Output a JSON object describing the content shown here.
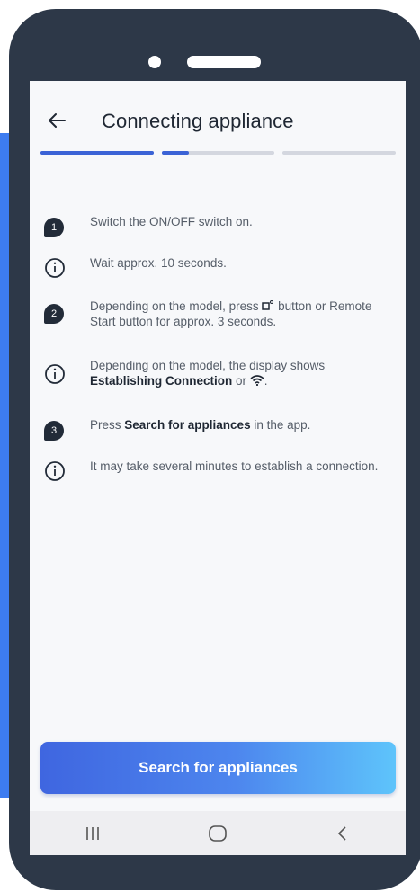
{
  "app": {
    "title": "Connecting appliance"
  },
  "progress": {
    "segments": [
      {
        "state": "complete"
      },
      {
        "state": "in-progress"
      },
      {
        "state": "pending"
      }
    ]
  },
  "steps": [
    {
      "type": "number",
      "badge": "1",
      "text_plain": "Switch the ON/OFF switch on."
    },
    {
      "type": "info",
      "icon": "info-icon",
      "text_plain": "Wait approx. 10 seconds."
    },
    {
      "type": "number",
      "badge": "2",
      "text_a": "Depending on the model, press ",
      "symbol": "remote-start-icon",
      "text_b": " button or Remote Start button for approx. 3 seconds."
    },
    {
      "type": "info",
      "icon": "info-icon",
      "text_a": "Depending on the model, the display shows ",
      "bold": "Establishing Connection",
      "text_b": " or ",
      "symbol": "wifi-icon",
      "text_c": "."
    },
    {
      "type": "number",
      "badge": "3",
      "text_a": "Press ",
      "bold": "Search for appliances",
      "text_b": " in the app."
    },
    {
      "type": "info",
      "icon": "info-icon",
      "text_plain": "It may take several minutes to establish a connection."
    }
  ],
  "cta": {
    "label": "Search for appliances"
  },
  "colors": {
    "accent": "#3b63d6",
    "badge": "#222b38",
    "phone_frame": "#2d3848"
  }
}
